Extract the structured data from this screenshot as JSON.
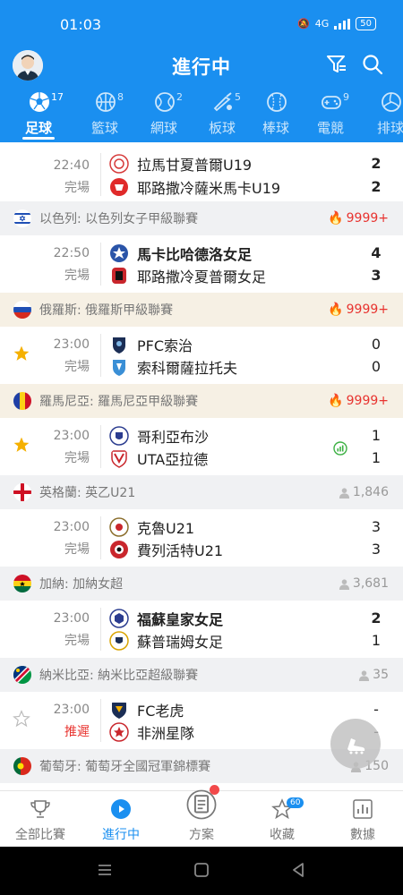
{
  "status": {
    "time": "01:03",
    "network": "4G",
    "battery": "50"
  },
  "header": {
    "title": "進行中"
  },
  "tabs": [
    {
      "label": "足球",
      "count": "17",
      "icon": "soccer-ball-icon"
    },
    {
      "label": "籃球",
      "count": "8",
      "icon": "basketball-icon"
    },
    {
      "label": "網球",
      "count": "2",
      "icon": "tennis-ball-icon"
    },
    {
      "label": "板球",
      "count": "5",
      "icon": "cricket-bat-icon"
    },
    {
      "label": "棒球",
      "count": "",
      "icon": "baseball-icon"
    },
    {
      "label": "電競",
      "count": "9",
      "icon": "gamepad-icon"
    },
    {
      "label": "排球",
      "count": "",
      "icon": "volleyball-icon"
    }
  ],
  "matches_top": {
    "time": "22:40",
    "status": "完場",
    "home": "拉馬甘夏普爾U19",
    "away": "耶路撒冷薩米馬卡U19",
    "home_score": "2",
    "away_score": "2"
  },
  "leagues": [
    {
      "name": "以色列: 以色列女子甲級聯賽",
      "metric": "9999+",
      "hot": true,
      "match": {
        "time": "22:50",
        "status": "完場",
        "home": "馬卡比哈德洛女足",
        "away": "耶路撒冷夏普爾女足",
        "home_score": "4",
        "away_score": "3",
        "home_bold": true
      }
    },
    {
      "name": "俄羅斯: 俄羅斯甲級聯賽",
      "metric": "9999+",
      "hot": true,
      "match": {
        "time": "23:00",
        "status": "完場",
        "home": "PFC索治",
        "away": "索科爾薩拉托夫",
        "home_score": "0",
        "away_score": "0"
      }
    },
    {
      "name": "羅馬尼亞: 羅馬尼亞甲級聯賽",
      "metric": "9999+",
      "hot": true,
      "match": {
        "time": "23:00",
        "status": "完場",
        "home": "哥利亞布沙",
        "away": "UTA亞拉德",
        "home_score": "1",
        "away_score": "1"
      }
    },
    {
      "name": "英格蘭: 英乙U21",
      "metric": "1,846",
      "hot": false,
      "match": {
        "time": "23:00",
        "status": "完場",
        "home": "克魯U21",
        "away": "費列活特U21",
        "home_score": "3",
        "away_score": "3"
      }
    },
    {
      "name": "加納: 加納女超",
      "metric": "3,681",
      "hot": false,
      "match": {
        "time": "23:00",
        "status": "完場",
        "home": "福蘇皇家女足",
        "away": "蘇普瑞姆女足",
        "home_score": "2",
        "away_score": "1",
        "home_bold": true
      }
    },
    {
      "name": "納米比亞: 納米比亞超級聯賽",
      "metric": "35",
      "hot": false,
      "match": {
        "time": "23:00",
        "status": "推遲",
        "home": "FC老虎",
        "away": "非洲星隊",
        "home_score": "-",
        "away_score": "-"
      }
    },
    {
      "name": "葡萄牙: 葡萄牙全國冠軍錦標賽",
      "metric": "150",
      "hot": false
    }
  ],
  "bottom_nav": [
    {
      "label": "全部比賽",
      "icon": "trophy-icon"
    },
    {
      "label": "進行中",
      "icon": "play-circle-icon"
    },
    {
      "label": "方案",
      "icon": "document-icon"
    },
    {
      "label": "收藏",
      "icon": "star-icon",
      "badge": "60"
    },
    {
      "label": "數據",
      "icon": "chart-icon"
    }
  ],
  "colors": {
    "brand": "#1a8ff0",
    "hot": "#e8332f",
    "star": "#f5b000"
  }
}
